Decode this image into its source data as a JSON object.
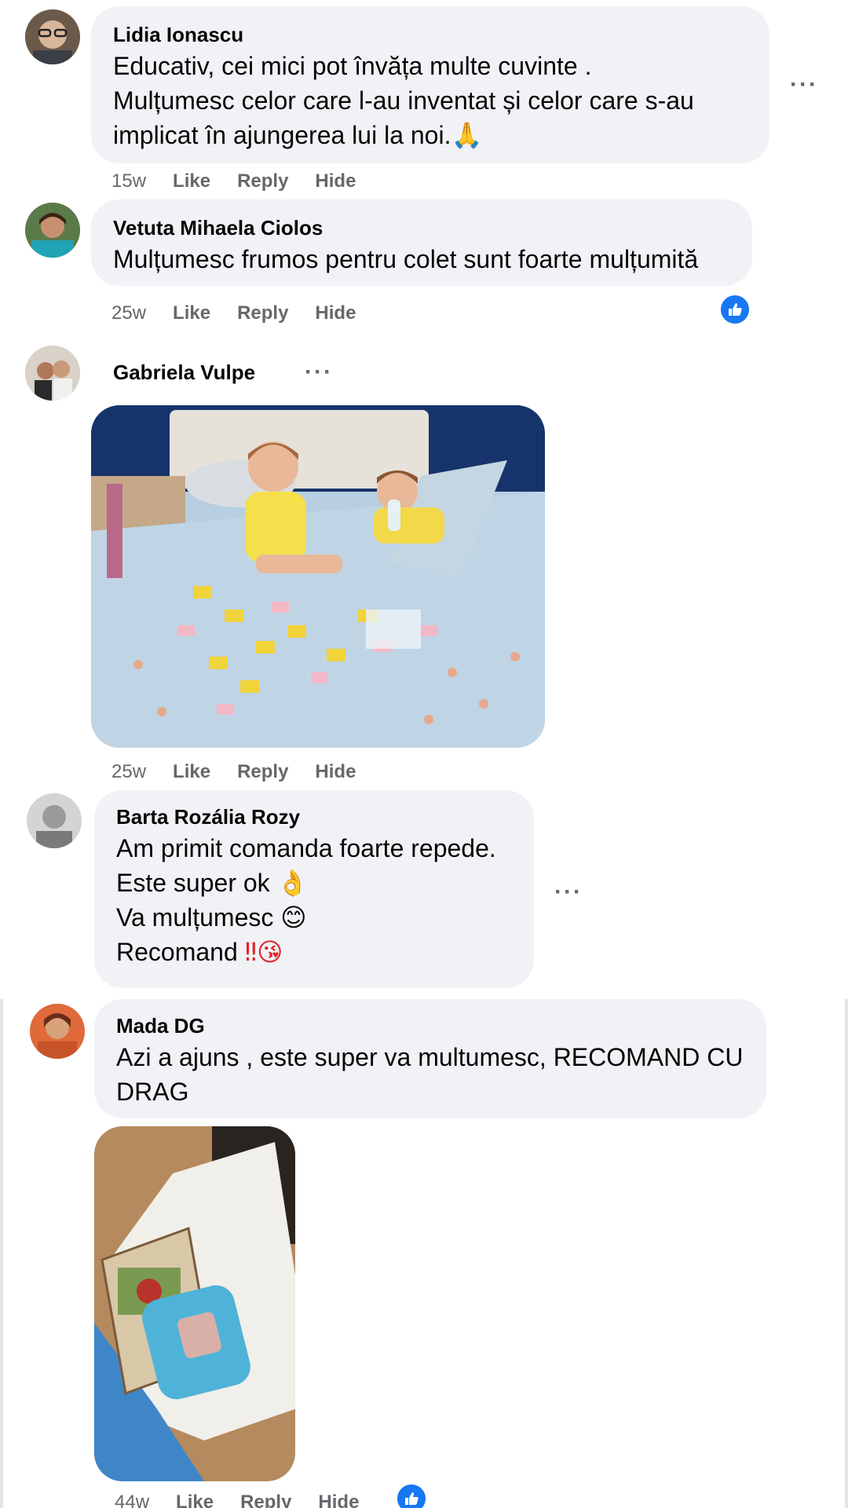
{
  "comments": [
    {
      "author": "Lidia Ionascu",
      "lines": [
        "Educativ, cei mici pot învăța multe cuvinte .",
        "Mulțumesc celor care l-au inventat și celor care s-au",
        "implicat în ajungerea lui la noi."
      ],
      "emoji": "🙏",
      "time": "15w",
      "like": "Like",
      "reply": "Reply",
      "hide": "Hide",
      "more": "···"
    },
    {
      "author": "Vetuta Mihaela Ciolos",
      "lines": [
        "Mulțumesc frumos pentru colet sunt foarte mulțumită"
      ],
      "time": "25w",
      "like": "Like",
      "reply": "Reply",
      "hide": "Hide"
    },
    {
      "author": "Gabriela Vulpe",
      "more": "···",
      "time": "25w",
      "like": "Like",
      "reply": "Reply",
      "hide": "Hide"
    },
    {
      "author": "Barta Rozália Rozy",
      "lines": [
        "Am primit comanda foarte repede.",
        "Este super ok",
        "Va mulțumesc",
        "Recomand"
      ],
      "emojis": [
        "👌",
        "😊",
        "‼😘"
      ],
      "more": "···"
    },
    {
      "author": "Mada DG",
      "lines": [
        "Azi a ajuns , este super va multumesc, RECOMAND CU",
        "DRAG"
      ],
      "time": "44w",
      "like": "Like",
      "reply": "Reply",
      "hide": "Hide"
    }
  ],
  "colors": {
    "bubble": "#f0f2f5",
    "meta": "#65676b",
    "like_blue": "#1877f2"
  },
  "icons": {
    "reaction": "thumbs-up-icon",
    "more": "more-options-icon"
  }
}
